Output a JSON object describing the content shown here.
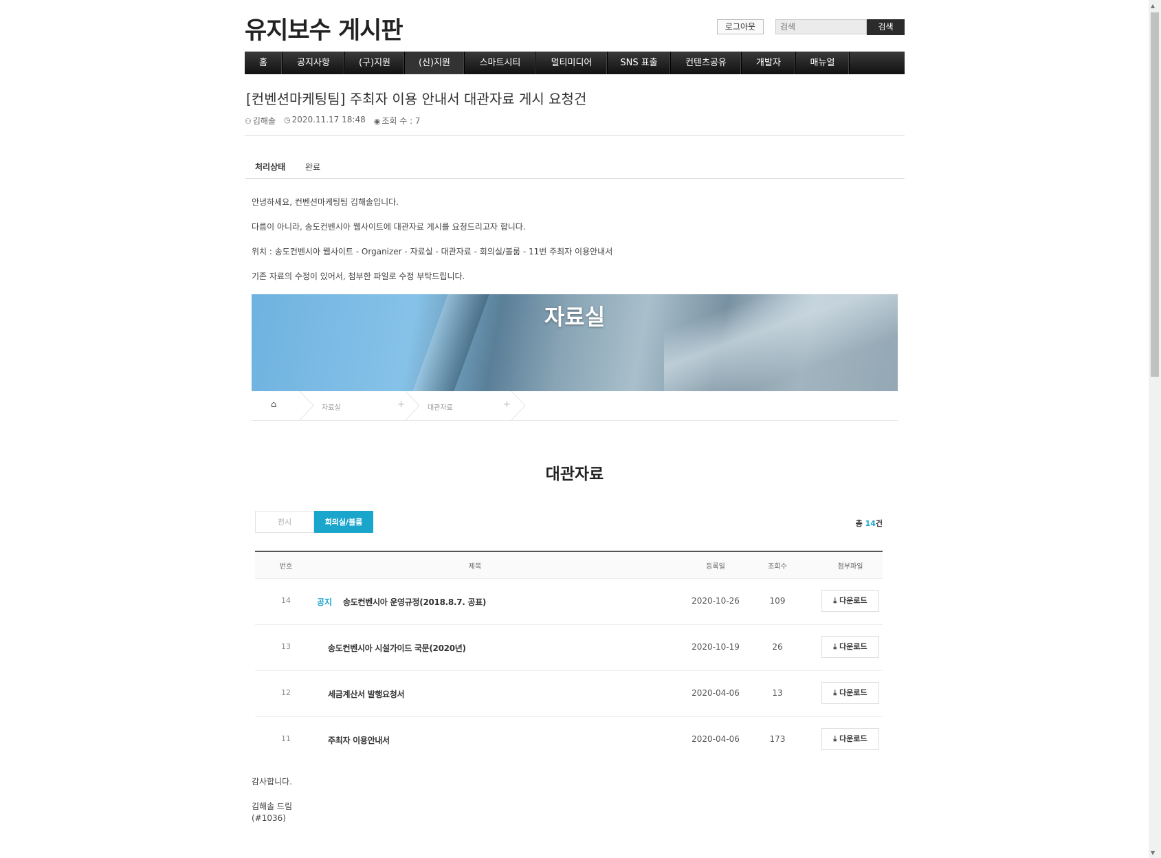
{
  "header": {
    "site_title": "유지보수 게시판",
    "logout_label": "로그아웃",
    "search_placeholder": "검색",
    "search_button": "검색"
  },
  "nav": {
    "items": [
      "홈",
      "공지사항",
      "(구)지원",
      "(신)지원",
      "스마트시티",
      "멀티미디어",
      "SNS 표출",
      "컨텐츠공유",
      "개발자",
      "매뉴얼"
    ]
  },
  "post": {
    "title": "[컨벤션마케팅팀] 주최자 이용 안내서 대관자료 게시 요청건",
    "author": "김해솔",
    "datetime": "2020.11.17 18:48",
    "views": "조회 수 : 7",
    "status_label": "처리상태",
    "status_value": "완료",
    "paragraphs": [
      "안녕하세요, 컨벤션마케팅팀 김해솔입니다.",
      "다름이 아니라, 송도컨벤시아 웹사이트에 대관자료 게시를 요청드리고자 합니다.",
      "위치 : 송도컨벤시아 웹사이트 - Organizer - 자료실 - 대관자료 - 회의실/볼룸 - 11번 주최자 이용안내서",
      "기존 자료의 수정이 있어서, 첨부한 파일로 수정 부탁드립니다."
    ],
    "closing": "감사합니다.",
    "signature": "김해솔 드림",
    "ref": "(#1036)"
  },
  "embed": {
    "banner_title": "자료실",
    "breadcrumb": [
      "자료실",
      "대관자료"
    ],
    "section_title": "대관자료",
    "tabs": [
      "전시",
      "회의실/볼룸"
    ],
    "active_tab": "회의실/볼룸",
    "total_prefix": "총 ",
    "total_count": "14",
    "total_suffix": "건",
    "columns": [
      "번호",
      "제목",
      "등록일",
      "조회수",
      "첨부파일"
    ],
    "download_label": "다운로드",
    "rows": [
      {
        "no": "14",
        "badge": "공지",
        "title": "송도컨벤시아 운영규정(2018.8.7. 공표)",
        "date": "2020-10-26",
        "views": "109"
      },
      {
        "no": "13",
        "badge": "",
        "title": "송도컨벤시아 시설가이드 국문(2020년)",
        "date": "2020-10-19",
        "views": "26"
      },
      {
        "no": "12",
        "badge": "",
        "title": "세금계산서 발행요청서",
        "date": "2020-04-06",
        "views": "13"
      },
      {
        "no": "11",
        "badge": "",
        "title": "주최자 이용안내서",
        "date": "2020-04-06",
        "views": "173"
      }
    ]
  },
  "colors": {
    "accent": "#1aa5cc",
    "nav_bg": "#1e1e1e",
    "search_button_bg": "#2b2b2b"
  }
}
